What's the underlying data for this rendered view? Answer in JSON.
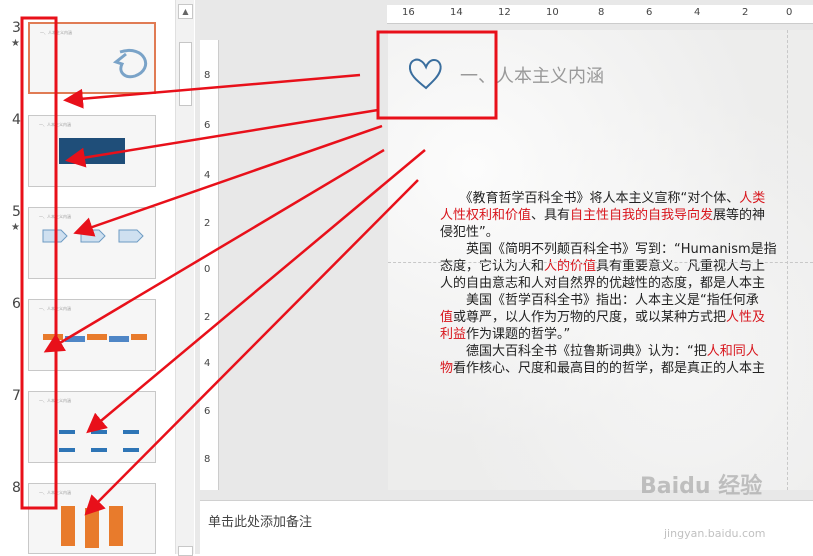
{
  "thumbnails": [
    {
      "number": "3",
      "star": "★",
      "title": "一、人本主义内涵"
    },
    {
      "number": "4",
      "star": "",
      "title": "一、人本主义内涵"
    },
    {
      "number": "5",
      "star": "★",
      "title": "一、人本主义内涵"
    },
    {
      "number": "6",
      "star": "",
      "title": "一、人本主义内涵"
    },
    {
      "number": "7",
      "star": "",
      "title": "一、人本主义内涵"
    },
    {
      "number": "8",
      "star": "",
      "title": "一、人本主义内涵"
    }
  ],
  "ruler": {
    "horizontal": [
      "16",
      "14",
      "12",
      "10",
      "8",
      "6",
      "4",
      "2",
      "0"
    ],
    "vertical": [
      "8",
      "6",
      "4",
      "2",
      "0",
      "2",
      "4",
      "6",
      "8"
    ]
  },
  "slide": {
    "title": "一、人本主义内涵",
    "p1": {
      "a": "《教育哲学百科全书》将人本主义宣称“对个体、",
      "a_red": "人类",
      "b_red": "人性权利和价值",
      "b": "、具有",
      "c_red": "自主性自我的自我导向发",
      "c": "展等的神",
      "d": "侵犯性”。"
    },
    "p2": {
      "a": "英国《简明不列颠百科全书》写到：“Humanism是指",
      "b": "态度，它认为人和",
      "b_red": "人的价值",
      "b2": "具有重要意义。凡重视人与上",
      "c": "人的自由意志和人对自然界的优越性的态度，都是人本主"
    },
    "p3": {
      "a": "美国《哲学百科全书》指出：人本主义是“指任何承",
      "b_red": "值",
      "b": "或尊严，以人作为万物的尺度，或以某种方式把",
      "b2_red": "人性及",
      "c_red": "利益",
      "c": "作为课题的哲学。”"
    },
    "p4": {
      "a": "德国大百科全书《拉鲁斯词典》认为：“把",
      "a_red": "人和同人",
      "b_red": "物",
      "b": "看作核心、尺度和最高目的的哲学，都是真正的人本主"
    }
  },
  "notes": {
    "placeholder": "单击此处添加备注"
  },
  "watermark": {
    "text": "Baidu 经验",
    "sub": "jingyan.baidu.com"
  },
  "colors": {
    "accent_red": "#e8101a",
    "selected_border": "#e07b54"
  }
}
